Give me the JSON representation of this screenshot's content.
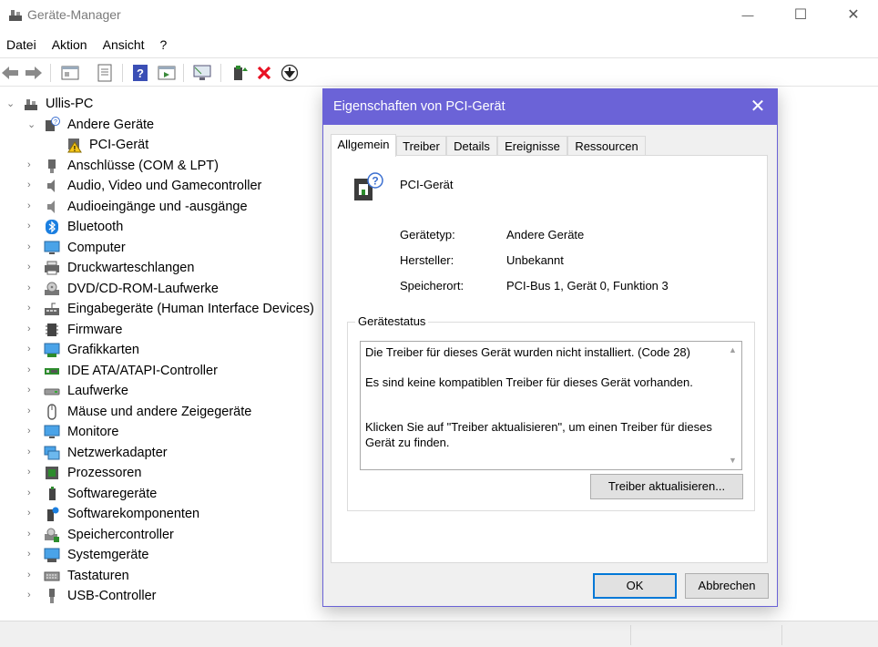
{
  "window": {
    "title": "Geräte-Manager",
    "controls": {
      "minimize": "—",
      "maximize": "☐",
      "close": "✕"
    }
  },
  "menu": [
    "Datei",
    "Aktion",
    "Ansicht",
    "?"
  ],
  "toolbar": {
    "icons": [
      "back-arrow-icon",
      "forward-arrow-icon",
      "properties-icon",
      "device-list-icon",
      "help-icon",
      "action-icon",
      "monitor-icon",
      "update-driver-icon",
      "uninstall-icon",
      "download-icon"
    ]
  },
  "tree": {
    "root": "Ullis-PC",
    "expanded_group": "Andere Geräte",
    "expanded_child": "PCI-Gerät",
    "categories": [
      "Anschlüsse (COM & LPT)",
      "Audio, Video und Gamecontroller",
      "Audioeingänge und -ausgänge",
      "Bluetooth",
      "Computer",
      "Druckwarteschlangen",
      "DVD/CD-ROM-Laufwerke",
      "Eingabegeräte (Human Interface Devices)",
      "Firmware",
      "Grafikkarten",
      "IDE ATA/ATAPI-Controller",
      "Laufwerke",
      "Mäuse und andere Zeigegeräte",
      "Monitore",
      "Netzwerkadapter",
      "Prozessoren",
      "Softwaregeräte",
      "Softwarekomponenten",
      "Speichercontroller",
      "Systemgeräte",
      "Tastaturen",
      "USB-Controller"
    ]
  },
  "dialog": {
    "title": "Eigenschaften von PCI-Gerät",
    "close": "✕",
    "tabs": [
      "Allgemein",
      "Treiber",
      "Details",
      "Ereignisse",
      "Ressourcen"
    ],
    "active_tab": "Allgemein",
    "device_name": "PCI-Gerät",
    "properties": [
      {
        "label": "Gerätetyp:",
        "value": "Andere Geräte"
      },
      {
        "label": "Hersteller:",
        "value": "Unbekannt"
      },
      {
        "label": "Speicherort:",
        "value": "PCI-Bus 1, Gerät 0, Funktion 3"
      }
    ],
    "status_group": "Gerätestatus",
    "status_lines": [
      "Die Treiber für dieses Gerät wurden nicht installiert. (Code 28)",
      "Es sind keine kompatiblen Treiber für dieses Gerät vorhanden.",
      "Klicken Sie auf \"Treiber aktualisieren\", um einen Treiber für dieses Gerät zu finden."
    ],
    "update_button": "Treiber aktualisieren...",
    "ok_button": "OK",
    "cancel_button": "Abbrechen"
  },
  "colors": {
    "dialog_title": "#6b63d7",
    "uninstall_red": "#e81123",
    "accent_blue": "#0078d7"
  }
}
